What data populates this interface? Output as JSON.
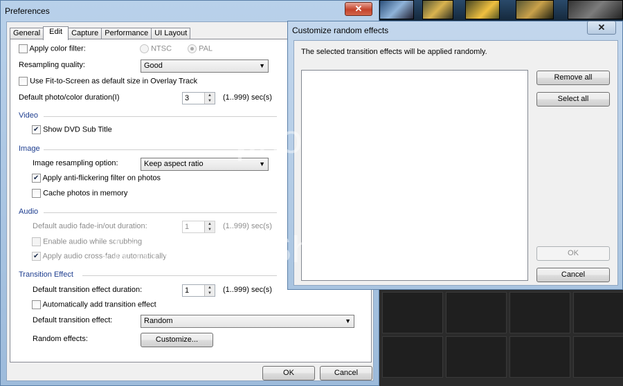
{
  "preferences": {
    "title": "Preferences",
    "close_glyph": "✕",
    "tabs": [
      {
        "label": "General"
      },
      {
        "label": "Edit"
      },
      {
        "label": "Capture"
      },
      {
        "label": "Performance"
      },
      {
        "label": "UI Layout"
      }
    ],
    "active_tab": "Edit",
    "apply_color_filter": {
      "label": "Apply color filter:",
      "checked": false
    },
    "ntsc": {
      "label": "NTSC",
      "selected": false
    },
    "pal": {
      "label": "PAL",
      "selected": true
    },
    "resampling_quality": {
      "label": "Resampling quality:",
      "value": "Good"
    },
    "fit_to_screen": {
      "label": "Use Fit-to-Screen as default size in Overlay Track",
      "checked": false
    },
    "default_duration": {
      "label": "Default photo/color duration(I)",
      "value": "3",
      "range": "(1..999) sec(s)"
    },
    "video": {
      "title": "Video",
      "show_dvd_subtitle": {
        "label": "Show DVD Sub Title",
        "checked": true
      }
    },
    "image": {
      "title": "Image",
      "resampling_option": {
        "label": "Image resampling option:",
        "value": "Keep aspect ratio"
      },
      "anti_flicker": {
        "label": "Apply anti-flickering filter on photos",
        "checked": true
      },
      "cache_photos": {
        "label": "Cache photos in memory",
        "checked": false
      }
    },
    "audio": {
      "title": "Audio",
      "fade_duration": {
        "label": "Default audio fade-in/out duration:",
        "value": "1",
        "range": "(1..999) sec(s)"
      },
      "enable_scrubbing": {
        "label": "Enable audio while scrubbing",
        "checked": false
      },
      "cross_fade": {
        "label": "Apply audio cross-fade automatically",
        "checked": true
      }
    },
    "transition": {
      "title": "Transition Effect",
      "duration": {
        "label": "Default transition effect duration:",
        "value": "1",
        "range": "(1..999) sec(s)"
      },
      "auto_add": {
        "label": "Automatically add transition effect",
        "checked": false
      },
      "default_effect": {
        "label": "Default transition effect:",
        "value": "Random"
      },
      "random_effects": {
        "label": "Random effects:",
        "button": "Customize..."
      }
    },
    "ok": "OK",
    "cancel": "Cancel"
  },
  "customize": {
    "title": "Customize random effects",
    "close_glyph": "✕",
    "message": "The selected transition effects will be applied randomly.",
    "remove_all": "Remove all",
    "select_all": "Select all",
    "ok": "OK",
    "cancel": "Cancel"
  },
  "watermark": {
    "brand": "photobucket",
    "tagline": "Join free. Share privately."
  },
  "colors": {
    "section_title": "#1d3d8f",
    "title_bar": "#b9d1ea",
    "close_button": "#c4432b"
  }
}
